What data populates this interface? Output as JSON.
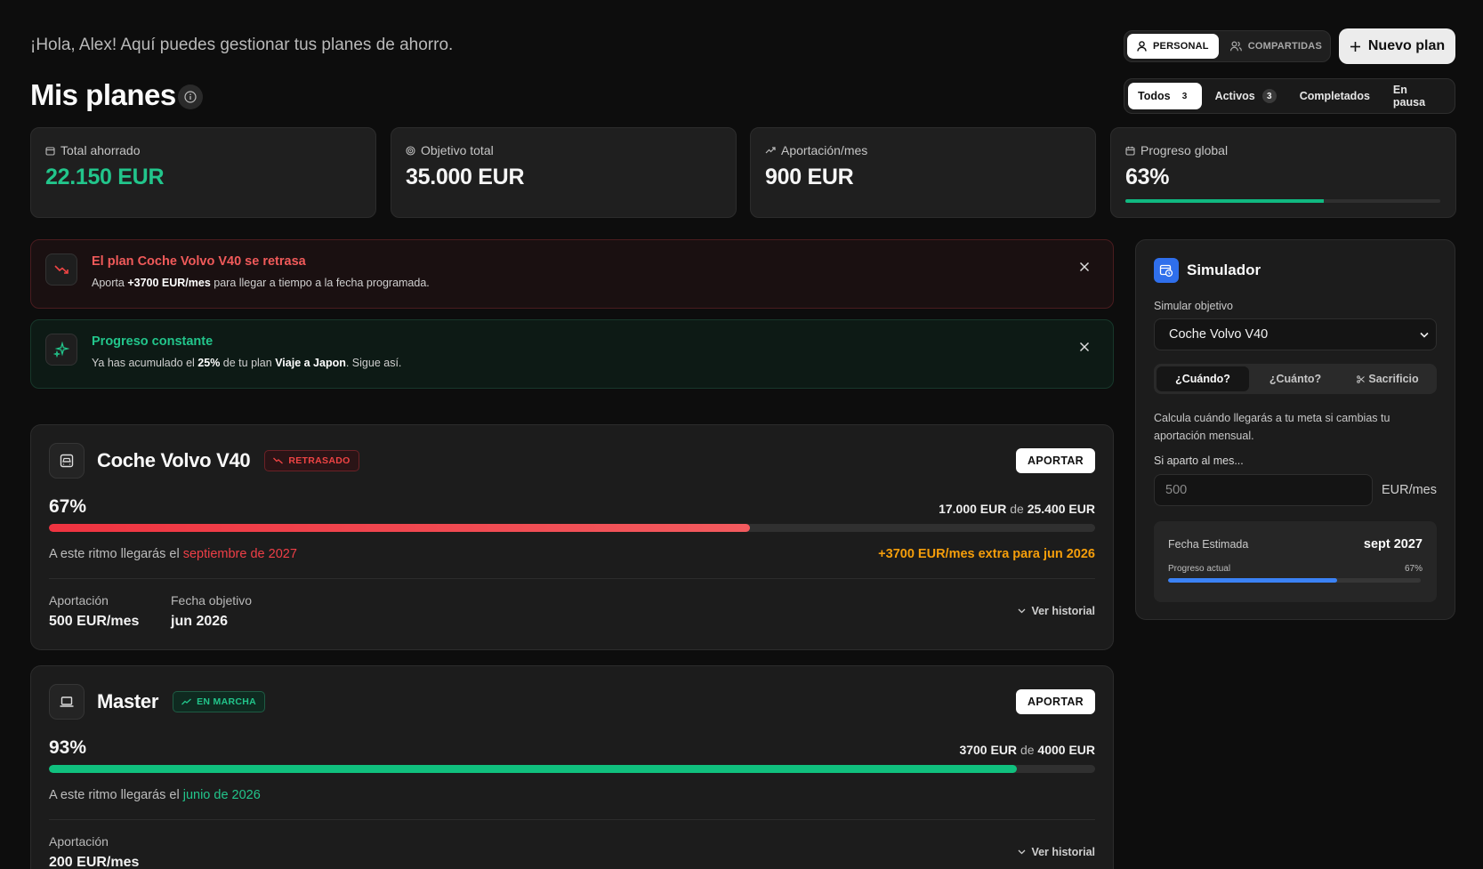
{
  "header": {
    "greeting": "¡Hola, Alex! Aquí puedes gestionar tus planes de ahorro.",
    "title": "Mis planes",
    "scope": [
      {
        "label": "PERSONAL",
        "icon": "user-icon",
        "active": true
      },
      {
        "label": "COMPARTIDAS",
        "icon": "users-icon",
        "active": false
      }
    ],
    "new_plan_label": "Nuevo plan",
    "filters": [
      {
        "label": "Todos",
        "count": "3",
        "active": true
      },
      {
        "label": "Activos",
        "count": "3",
        "active": false
      },
      {
        "label": "Completados",
        "count": null,
        "active": false
      },
      {
        "label": "En pausa",
        "count": null,
        "active": false
      }
    ]
  },
  "stats": [
    {
      "label": "Total ahorrado",
      "value": "22.150 EUR",
      "icon": "wallet-icon",
      "accent": "#22c58b"
    },
    {
      "label": "Objetivo total",
      "value": "35.000 EUR",
      "icon": "target-icon"
    },
    {
      "label": "Aportación/mes",
      "value": "900 EUR",
      "icon": "trend-up-icon"
    },
    {
      "label": "Progreso global",
      "value": "63%",
      "icon": "calendar-icon",
      "progress": 0.63
    }
  ],
  "alerts": [
    {
      "type": "warning",
      "title": "El plan Coche Volvo V40 se retrasa",
      "text_before": "Aporta ",
      "text_bold": "+3700 EUR/mes",
      "text_after": " para llegar a tiempo a la fecha programada."
    },
    {
      "type": "success",
      "title": "Progreso constante",
      "text_1": "Ya has acumulado el ",
      "bold_1": "25%",
      "text_2": " de tu plan ",
      "bold_2": "Viaje a Japon",
      "text_3": ". Sigue así."
    }
  ],
  "plans": [
    {
      "name": "Coche Volvo V40",
      "icon": "car-icon",
      "badge": "RETRASADO",
      "action": "APORTAR",
      "percent": "67%",
      "progress": 0.67,
      "saved": "17.000 EUR",
      "of": "de",
      "target": "25.400 EUR",
      "pace_text": "A este ritmo llegarás el ",
      "pace_date": "septiembre de 2027",
      "extra": "+3700 EUR/mes extra para jun 2026",
      "contribution_label": "Aportación",
      "contribution_value": "500 EUR/mes",
      "target_date_label": "Fecha objetivo",
      "target_date_value": "jun 2026",
      "history_label": "Ver historial"
    },
    {
      "name": "Master",
      "icon": "laptop-icon",
      "badge": "EN MARCHA",
      "action": "APORTAR",
      "percent": "93%",
      "progress": 0.925,
      "saved": "3700 EUR",
      "of": "de",
      "target": "4000 EUR",
      "pace_text": "A este ritmo llegarás el ",
      "pace_date": "junio de 2026",
      "contribution_label": "Aportación",
      "contribution_value": "200 EUR/mes",
      "history_label": "Ver historial"
    }
  ],
  "simulator": {
    "title": "Simulador",
    "select_label": "Simular objetivo",
    "selected_plan": "Coche Volvo V40",
    "tabs": [
      {
        "label": "¿Cuándo?",
        "active": true
      },
      {
        "label": "¿Cuánto?",
        "active": false
      },
      {
        "label": "Sacrificio",
        "active": false,
        "icon": "scissors-icon"
      }
    ],
    "description": "Calcula cuándo llegarás a tu meta si cambias tu aportación mensual.",
    "input_label": "Si aparto al mes...",
    "input_placeholder": "500",
    "input_unit": "EUR/mes",
    "result_label": "Fecha Estimada",
    "result_value": "sept 2027",
    "progress_label": "Progreso actual",
    "progress_value": "67%",
    "progress": 0.67
  },
  "colors": {
    "background": "#0d0d0d",
    "success": "#22c58b",
    "danger": "#ef4444",
    "warning": "#f59e0b",
    "info": "#3b82f6"
  }
}
